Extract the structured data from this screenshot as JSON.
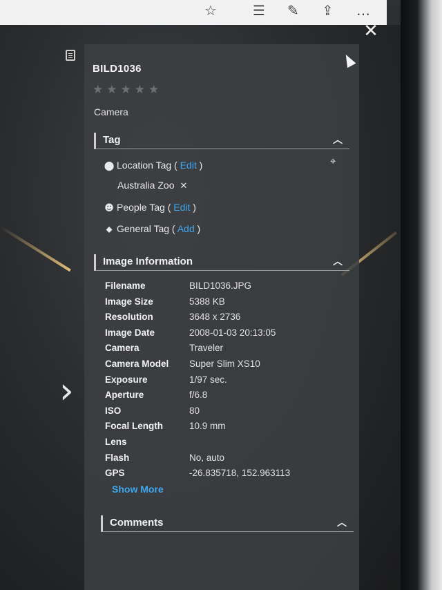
{
  "browser": {
    "icons": [
      "star-icon",
      "reading-list-icon",
      "pen-icon",
      "share-icon",
      "more-icon"
    ],
    "glyphs": [
      "☆",
      "☰",
      "✎",
      "⇪",
      "…"
    ]
  },
  "viewer": {
    "close_glyph": "✕",
    "next_glyph": "›"
  },
  "panel": {
    "title": "BILD1036",
    "stars_glyph": "★★★★★",
    "rating": 0,
    "camera_label": "Camera",
    "tag_section": {
      "heading": "Tag",
      "location": {
        "label": "Location Tag (",
        "action": "Edit",
        "close": ")",
        "value": "Australia Zoo",
        "remove_glyph": "✕"
      },
      "people": {
        "label": "People Tag (",
        "action": "Edit",
        "close": ")"
      },
      "general": {
        "label": "General Tag (",
        "action": "Add",
        "close": ")"
      }
    },
    "info_section": {
      "heading": "Image Information",
      "rows": [
        {
          "key": "Filename",
          "value": "BILD1036.JPG"
        },
        {
          "key": "Image Size",
          "value": "5388 KB"
        },
        {
          "key": "Resolution",
          "value": "3648 x 2736"
        },
        {
          "key": "Image Date",
          "value": "2008-01-03 20:13:05"
        },
        {
          "key": "Camera",
          "value": "Traveler"
        },
        {
          "key": "Camera Model",
          "value": "Super Slim XS10"
        },
        {
          "key": "Exposure",
          "value": "1/97 sec."
        },
        {
          "key": "Aperture",
          "value": "f/6.8"
        },
        {
          "key": "ISO",
          "value": "80"
        },
        {
          "key": "Focal Length",
          "value": "10.9 mm"
        },
        {
          "key": "Lens",
          "value": ""
        },
        {
          "key": "Flash",
          "value": "No, auto"
        },
        {
          "key": "GPS",
          "value": "-26.835718, 152.963113"
        }
      ],
      "show_more": "Show More"
    },
    "comments_section": {
      "heading": "Comments"
    },
    "chevron_glyph": "︿"
  },
  "colors": {
    "link": "#3ea8f0",
    "panel_bg": "#3c3f42"
  }
}
